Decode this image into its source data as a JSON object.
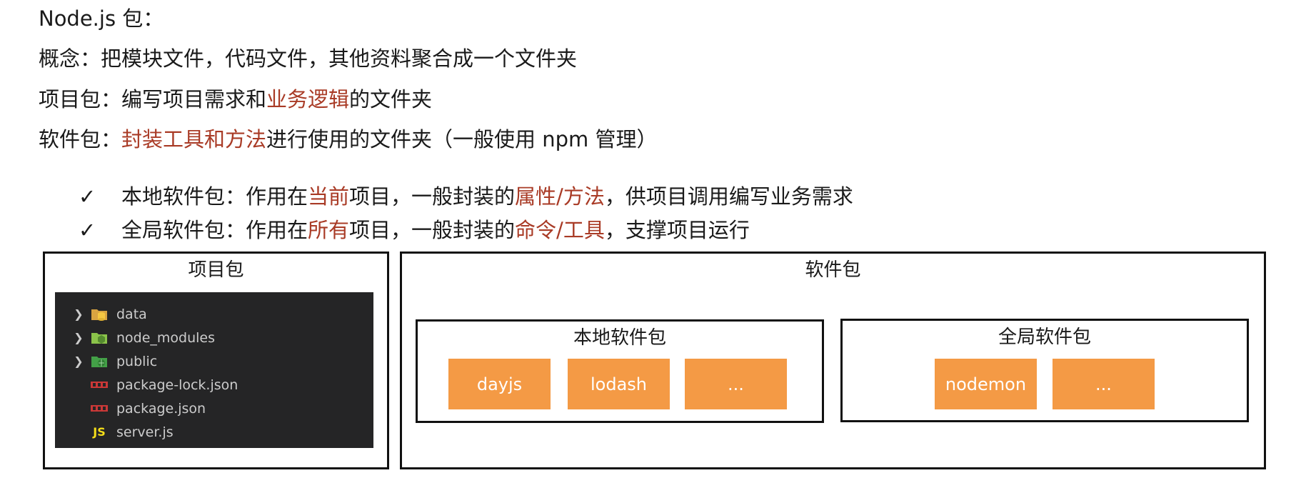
{
  "heading": "Node.js 包：",
  "concept": {
    "label": "概念：",
    "text": "把模块文件，代码文件，其他资料聚合成一个文件夹"
  },
  "project_pkg": {
    "label": "项目包：",
    "pre": "编写项目需求和",
    "hl": "业务逻辑",
    "post": "的文件夹"
  },
  "software_pkg": {
    "label": "软件包：",
    "hl": "封装工具和方法",
    "post": "进行使用的文件夹（一般使用 npm 管理）"
  },
  "bullets": [
    {
      "check": "✓",
      "pre": "本地软件包：作用在",
      "hl1": "当前",
      "mid": "项目，一般封装的",
      "hl2": "属性/方法",
      "post": "，供项目调用编写业务需求"
    },
    {
      "check": "✓",
      "pre": "全局软件包：作用在",
      "hl1": "所有",
      "mid": "项目，一般封装的",
      "hl2": "命令/工具",
      "post": "，支撑项目运行"
    }
  ],
  "project_box": {
    "title": "项目包",
    "files": [
      {
        "name": "data",
        "icon": "folder-database-icon"
      },
      {
        "name": "node_modules",
        "icon": "folder-node-icon"
      },
      {
        "name": "public",
        "icon": "folder-public-icon"
      },
      {
        "name": "package-lock.json",
        "icon": "npm-icon"
      },
      {
        "name": "package.json",
        "icon": "npm-icon"
      },
      {
        "name": "server.js",
        "icon": "javascript-icon",
        "icon_text": "JS"
      }
    ]
  },
  "software_box": {
    "title": "软件包",
    "local": {
      "title": "本地软件包",
      "items": [
        "dayjs",
        "lodash",
        "..."
      ]
    },
    "global": {
      "title": "全局软件包",
      "items": [
        "nodemon",
        "..."
      ]
    }
  },
  "colors": {
    "highlight": "#a93b26",
    "orange": "#f49a45",
    "explorer_bg": "#252526"
  }
}
